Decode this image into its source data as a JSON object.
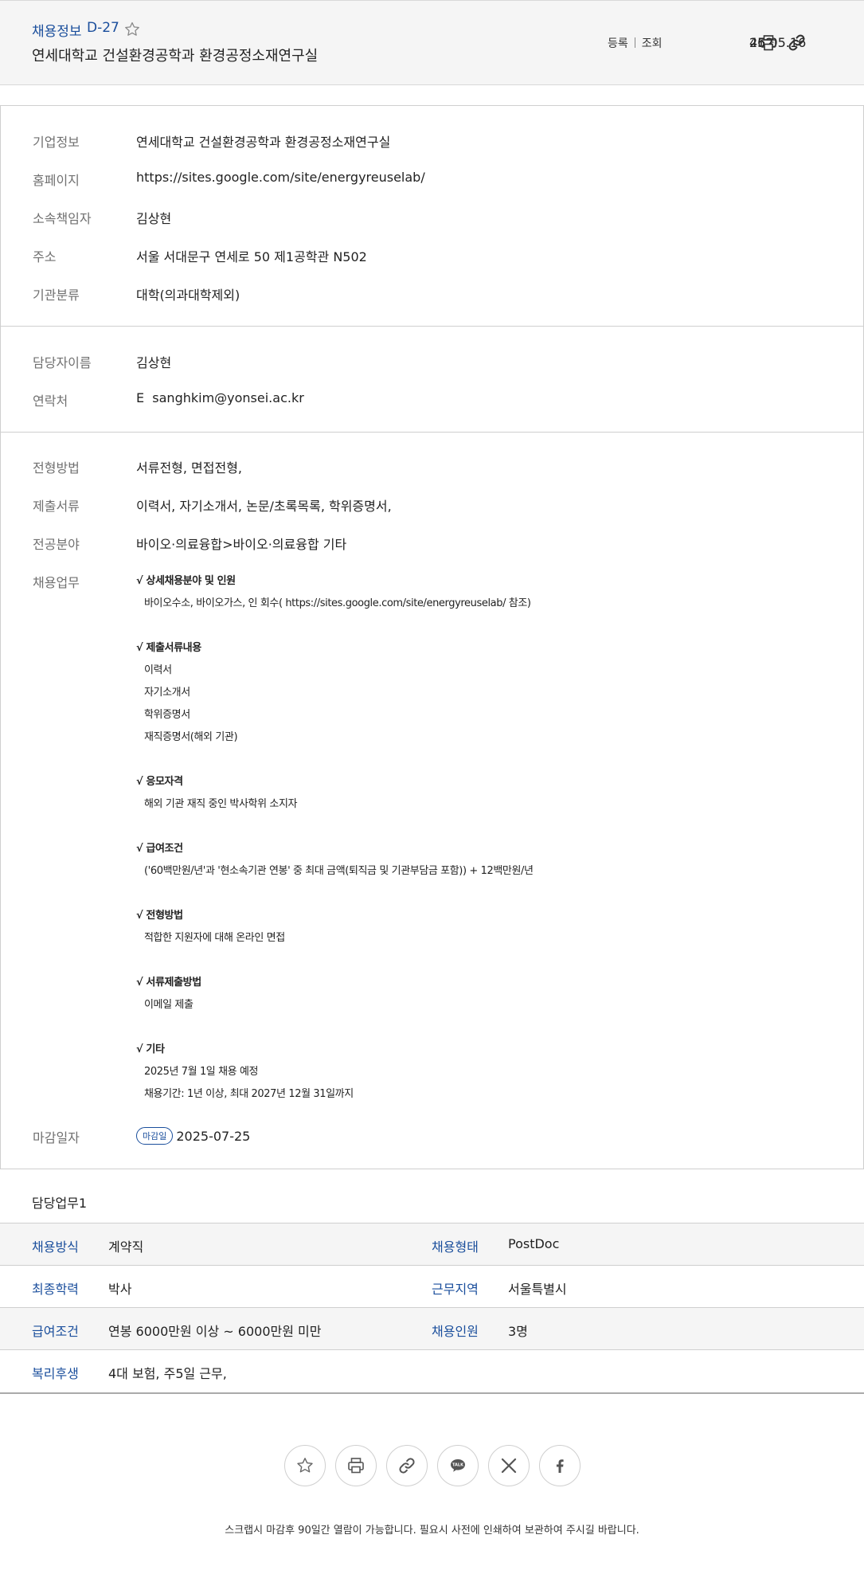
{
  "header": {
    "category": "채용정보",
    "dday": "D-27",
    "title": "연세대학교 건설환경공학과 환경공정소재연구실",
    "registered_label": "등록",
    "registered_date": "25.05.16",
    "views_label": "조회",
    "views_count": "462"
  },
  "company": {
    "rows": [
      {
        "label": "기업정보",
        "value": "연세대학교 건설환경공학과 환경공정소재연구실"
      },
      {
        "label": "홈페이지",
        "value": "https://sites.google.com/site/energyreuselab/"
      },
      {
        "label": "소속책임자",
        "value": "김상현"
      },
      {
        "label": "주소",
        "value": "서울 서대문구 연세로 50 제1공학관 N502"
      },
      {
        "label": "기관분류",
        "value": "대학(의과대학제외)"
      }
    ]
  },
  "contact": {
    "name_label": "담당자이름",
    "name": "김상현",
    "phone_label": "연락처",
    "email_prefix": "E",
    "email": "sanghkim@yonsei.ac.kr"
  },
  "recruit": {
    "rows": [
      {
        "label": "전형방법",
        "value": "서류전형, 면접전형,"
      },
      {
        "label": "제출서류",
        "value": "이력서, 자기소개서, 논문/초록목록, 학위증명서,"
      },
      {
        "label": "전공분야",
        "value": "바이오·의료융합>바이오·의료융합 기타"
      }
    ],
    "duty_label": "채용업무",
    "duty_sections": [
      {
        "title": "√ 상세채용분야 및 인원",
        "lines": [
          "바이오수소, 바이오가스, 인 회수( https://sites.google.com/site/energyreuselab/ 참조)"
        ]
      },
      {
        "title": "√ 제출서류내용",
        "lines": [
          "이력서",
          "자기소개서",
          "학위증명서",
          "재직증명서(해외 기관)"
        ]
      },
      {
        "title": "√ 응모자격",
        "lines": [
          "해외 기관 재직 중인 박사학위 소지자"
        ]
      },
      {
        "title": "√ 급여조건",
        "lines": [
          "('60백만원/년'과 '현소속기관 연봉' 중 최대 금액(퇴직금 및 기관부담금 포함)) + 12백만원/년"
        ]
      },
      {
        "title": "√ 전형방법",
        "lines": [
          "적합한 지원자에 대해 온라인 면접"
        ]
      },
      {
        "title": "√ 서류제출방법",
        "lines": [
          "이메일 제출"
        ]
      },
      {
        "title": "√ 기타",
        "lines": [
          "2025년 7월 1일 채용 예정",
          "채용기간: 1년 이상, 최대 2027년 12월 31일까지"
        ]
      }
    ],
    "deadline_label": "마감일자",
    "deadline_badge": "마감일",
    "deadline": "2025-07-25"
  },
  "duty": {
    "heading": "담당업무1",
    "rows": [
      {
        "k1": "채용방식",
        "v1": "계약직",
        "k2": "채용형태",
        "v2": "PostDoc"
      },
      {
        "k1": "최종학력",
        "v1": "박사",
        "k2": "근무지역",
        "v2": "서울특별시"
      },
      {
        "k1": "급여조건",
        "v1": "연봉 6000만원 이상 ~ 6000만원 미만",
        "k2": "채용인원",
        "v2": "3명"
      },
      {
        "k1": "복리후생",
        "v1": "4대 보험, 주5일 근무,"
      }
    ]
  },
  "share": {
    "icons": [
      "star-icon",
      "print-icon",
      "link-icon",
      "kakaotalk-icon",
      "x-icon",
      "facebook-icon"
    ],
    "kakao_text": "TALK"
  },
  "footer": {
    "note": "스크랩시 마감후 90일간 열람이 가능합니다. 필요시 사전에 인쇄하여 보관하여 주시길 바랍니다."
  },
  "colors": {
    "accent": "#1a4e9c",
    "header_bg": "#f5f5f5",
    "label": "#707070",
    "border": "#cfcfcf"
  }
}
